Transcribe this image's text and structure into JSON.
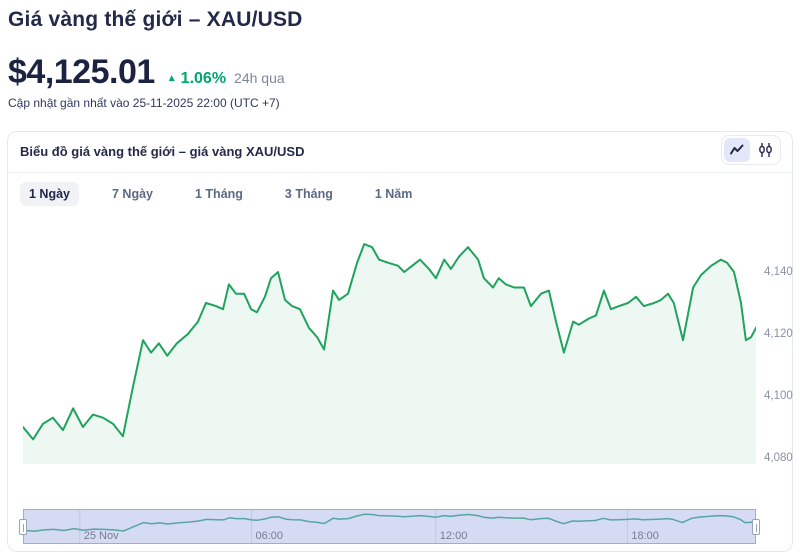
{
  "page": {
    "title": "Giá vàng thế giới – XAU/USD",
    "price": "$4,125.01",
    "change_pct": "1.06%",
    "change_period": "24h qua",
    "updated": "Cập nhật gần nhất vào 25-11-2025 22:00 (UTC +7)",
    "up_arrow_glyph": "▲"
  },
  "card": {
    "title": "Biểu đồ giá vàng thế giới – giá vàng XAU/USD",
    "tabs": [
      {
        "label": "1 Ngày",
        "active": true
      },
      {
        "label": "7 Ngày",
        "active": false
      },
      {
        "label": "1 Tháng",
        "active": false
      },
      {
        "label": "3 Tháng",
        "active": false
      },
      {
        "label": "1 Năm",
        "active": false
      }
    ],
    "chart_type_buttons": [
      {
        "name": "line",
        "active": true
      },
      {
        "name": "candlestick",
        "active": false
      }
    ]
  },
  "colors": {
    "accent_green": "#00a76d",
    "line_green": "#1fa35d",
    "line_fill": "rgba(35,165,96,0.08)",
    "navigator_bg": "#d6dbf4",
    "navigator_line": "#56a79f",
    "dark_navy": "#232949"
  },
  "chart_data": {
    "type": "line",
    "title": "Biểu đồ giá vàng thế giới – giá vàng XAU/USD",
    "series_name": "XAU/USD",
    "x_span_hours": 24,
    "ylim": [
      4078,
      4152
    ],
    "y_axis_side": "right",
    "grid": false,
    "y_ticks": [
      {
        "label": "4,140",
        "value": 4140
      },
      {
        "label": "4,120",
        "value": 4120
      },
      {
        "label": "4,100",
        "value": 4100
      },
      {
        "label": "4,080",
        "value": 4080
      }
    ],
    "navigator": {
      "ticks": [
        {
          "label": "25 Nov",
          "h": 1.83
        },
        {
          "label": "06:00",
          "h": 7.47
        },
        {
          "label": "12:00",
          "h": 13.52
        },
        {
          "label": "18:00",
          "h": 19.81
        }
      ]
    },
    "points": [
      [
        0,
        4090
      ],
      [
        0.33,
        4086
      ],
      [
        0.65,
        4091
      ],
      [
        0.98,
        4093
      ],
      [
        1.31,
        4089
      ],
      [
        1.64,
        4096
      ],
      [
        1.96,
        4090
      ],
      [
        2.29,
        4094
      ],
      [
        2.62,
        4093
      ],
      [
        2.95,
        4091
      ],
      [
        3.27,
        4087
      ],
      [
        3.6,
        4103
      ],
      [
        3.93,
        4118
      ],
      [
        4.19,
        4114
      ],
      [
        4.45,
        4117
      ],
      [
        4.72,
        4113
      ],
      [
        5.04,
        4117
      ],
      [
        5.4,
        4120
      ],
      [
        5.73,
        4124
      ],
      [
        5.99,
        4130
      ],
      [
        6.32,
        4129
      ],
      [
        6.55,
        4128
      ],
      [
        6.74,
        4136
      ],
      [
        6.97,
        4133
      ],
      [
        7.24,
        4133
      ],
      [
        7.47,
        4128
      ],
      [
        7.66,
        4127
      ],
      [
        7.92,
        4132
      ],
      [
        8.12,
        4138
      ],
      [
        8.35,
        4140
      ],
      [
        8.58,
        4131
      ],
      [
        8.81,
        4129
      ],
      [
        9.07,
        4128
      ],
      [
        9.36,
        4122
      ],
      [
        9.63,
        4119
      ],
      [
        9.86,
        4115
      ],
      [
        10.15,
        4134
      ],
      [
        10.35,
        4131
      ],
      [
        10.64,
        4133
      ],
      [
        10.94,
        4143
      ],
      [
        11.17,
        4149
      ],
      [
        11.43,
        4148
      ],
      [
        11.66,
        4144
      ],
      [
        11.95,
        4143
      ],
      [
        12.28,
        4142
      ],
      [
        12.48,
        4140
      ],
      [
        12.74,
        4142
      ],
      [
        13.0,
        4144
      ],
      [
        13.29,
        4141
      ],
      [
        13.52,
        4138
      ],
      [
        13.79,
        4144
      ],
      [
        14.01,
        4141
      ],
      [
        14.28,
        4145
      ],
      [
        14.57,
        4148
      ],
      [
        14.9,
        4144
      ],
      [
        15.09,
        4138
      ],
      [
        15.39,
        4135
      ],
      [
        15.58,
        4138
      ],
      [
        15.81,
        4136
      ],
      [
        16.08,
        4135
      ],
      [
        16.4,
        4135
      ],
      [
        16.63,
        4129
      ],
      [
        16.96,
        4133
      ],
      [
        17.22,
        4134
      ],
      [
        17.45,
        4124
      ],
      [
        17.71,
        4114
      ],
      [
        18.01,
        4124
      ],
      [
        18.2,
        4123
      ],
      [
        18.53,
        4125
      ],
      [
        18.76,
        4126
      ],
      [
        19.02,
        4134
      ],
      [
        19.25,
        4128
      ],
      [
        19.51,
        4129
      ],
      [
        19.81,
        4130
      ],
      [
        20.07,
        4132
      ],
      [
        20.33,
        4129
      ],
      [
        20.66,
        4130
      ],
      [
        20.89,
        4131
      ],
      [
        21.12,
        4133
      ],
      [
        21.31,
        4130
      ],
      [
        21.61,
        4118
      ],
      [
        21.94,
        4135
      ],
      [
        22.2,
        4139
      ],
      [
        22.53,
        4142
      ],
      [
        22.85,
        4144
      ],
      [
        23.05,
        4143
      ],
      [
        23.28,
        4140
      ],
      [
        23.51,
        4130
      ],
      [
        23.67,
        4118
      ],
      [
        23.84,
        4119
      ],
      [
        24,
        4122
      ]
    ]
  }
}
